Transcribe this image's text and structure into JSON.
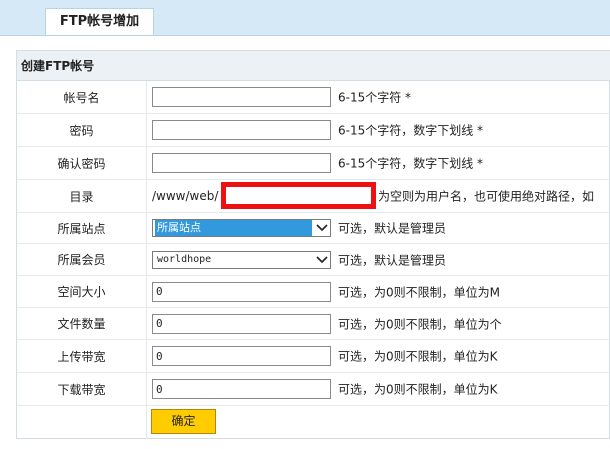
{
  "tab": {
    "title": "FTP帐号增加"
  },
  "panel": {
    "header": "创建FTP帐号"
  },
  "form": {
    "account_name": {
      "label": "帐号名",
      "value": "",
      "hint": "6-15个字符 *"
    },
    "password": {
      "label": "密码",
      "value": "",
      "hint": "6-15个字符，数字下划线 *"
    },
    "confirm_password": {
      "label": "确认密码",
      "value": "",
      "hint": "6-15个字符，数字下划线 *"
    },
    "directory": {
      "label": "目录",
      "prefix": "/www/web/",
      "hint": "为空则为用户名，也可使用绝对路径，如"
    },
    "site": {
      "label": "所属站点",
      "selected": "所属站点",
      "hint": "可选，默认是管理员"
    },
    "member": {
      "label": "所属会员",
      "selected": "worldhope",
      "hint": "可选，默认是管理员"
    },
    "space": {
      "label": "空间大小",
      "value": "0",
      "hint": "可选，为0则不限制，单位为M"
    },
    "file_count": {
      "label": "文件数量",
      "value": "0",
      "hint": "可选，为0则不限制，单位为个"
    },
    "upload_bw": {
      "label": "上传带宽",
      "value": "0",
      "hint": "可选，为0则不限制，单位为K"
    },
    "download_bw": {
      "label": "下载带宽",
      "value": "0",
      "hint": "可选，为0则不限制，单位为K"
    },
    "submit_label": "确定"
  },
  "colors": {
    "tabbar": "#d6e9f6",
    "highlight": "#3399dd",
    "button": "#ffcc00",
    "redact": "#ee1111"
  },
  "icons": {
    "dropdown": "chevron-down-icon"
  }
}
